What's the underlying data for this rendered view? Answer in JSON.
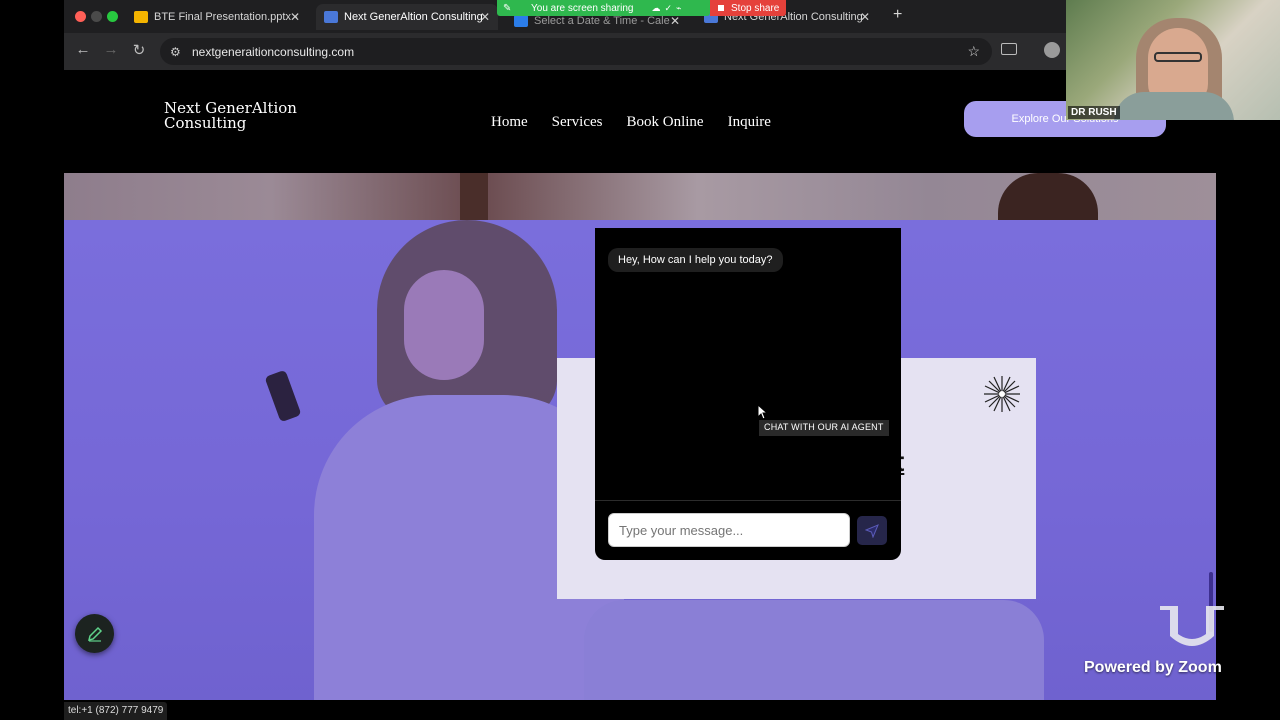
{
  "browser": {
    "tabs": [
      {
        "title": "BTE Final Presentation.pptx -",
        "active": false,
        "favicon_color": "#f4b400"
      },
      {
        "title": "Next GenerAltion Consulting",
        "active": true,
        "favicon_color": "#4a78d8"
      },
      {
        "title": "Select a Date & Time - Cale",
        "active": false,
        "favicon_color": "#2b7de9"
      },
      {
        "title": "Next GenerAltion Consulting",
        "active": false,
        "favicon_color": "#4a78d8"
      }
    ],
    "url": "nextgeneraitionconsulting.com",
    "status_url": "tel:+1 (872) 777 9479"
  },
  "screen_share": {
    "label": "You are screen sharing",
    "stop_label": "Stop share"
  },
  "site": {
    "brand_line1": "Next GenerAltion",
    "brand_line2": "Consulting",
    "nav": [
      "Home",
      "Services",
      "Book Online",
      "Inquire"
    ],
    "cta_label": "Explore Our Solutions",
    "card_heading_fragment": "t"
  },
  "chat": {
    "greeting": "Hey, How can I help you today?",
    "input_placeholder": "Type your message...",
    "tooltip": "CHAT WITH OUR AI AGENT"
  },
  "zoom": {
    "participant_name": "DR RUSH",
    "powered_by": "Powered by Zoom"
  },
  "colors": {
    "hero_overlay": "#7a6edc",
    "cta": "#a79eef",
    "share_green": "#2fb84e",
    "stop_red": "#e5413b"
  }
}
